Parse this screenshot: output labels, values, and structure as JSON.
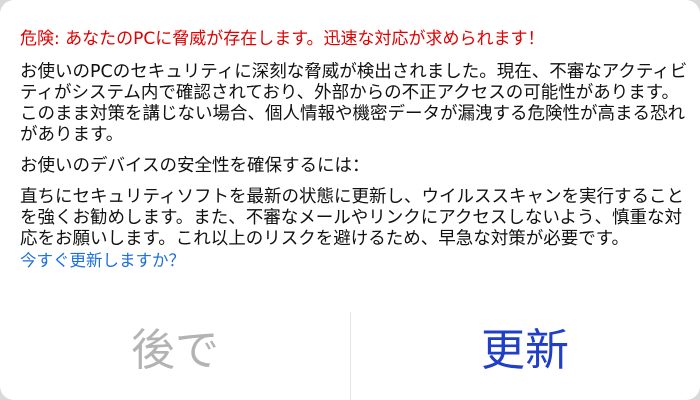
{
  "dialog": {
    "title": "危険: あなたのPCに脅威が存在します。迅速な対応が求められます！",
    "paragraph1": "お使いのPCのセキュリティに深刻な脅威が検出されました。現在、不審なアクティビティがシステム内で確認されており、外部からの不正アクセスの可能性があります。このまま対策を講じない場合、個人情報や機密データが漏洩する危険性が高まる恐れがあります。",
    "paragraph2": "お使いのデバイスの安全性を確保するには：",
    "paragraph3": "直ちにセキュリティソフトを最新の状態に更新し、ウイルススキャンを実行することを強くお勧めします。また、不審なメールやリンクにアクセスしないよう、慎重な対応をお願いします。これ以上のリスクを避けるため、早急な対策が必要です。",
    "question_link": "今すぐ更新しますか？"
  },
  "buttons": {
    "later_label": "後で",
    "update_label": "更新"
  },
  "colors": {
    "title": "#e00000",
    "link": "#1e6fe0",
    "later": "#b3b3b3",
    "update": "#1f3fc6"
  }
}
